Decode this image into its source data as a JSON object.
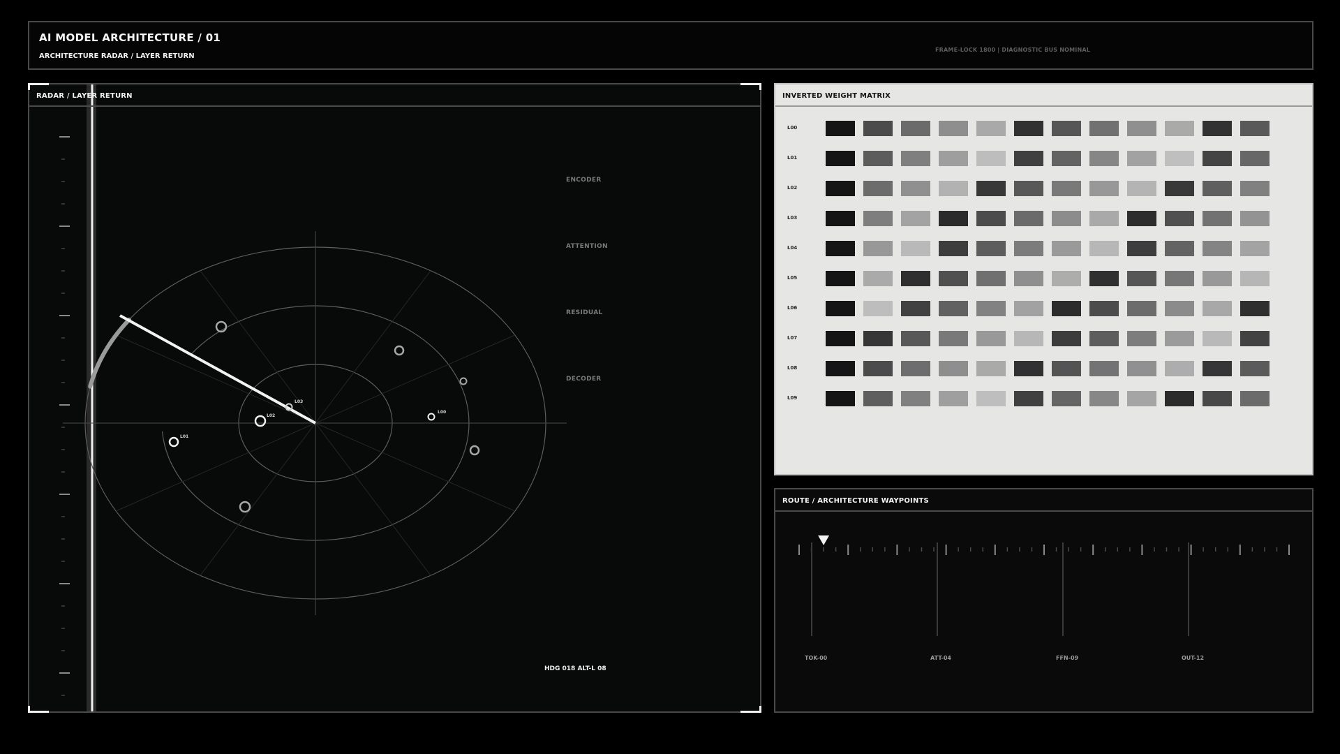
{
  "header": {
    "title": "AI MODEL ARCHITECTURE / 01",
    "subtitle": "ARCHITECTURE RADAR / LAYER RETURN",
    "status": "FRAME-LOCK 1800 | DIAGNOSTIC BUS NOMINAL"
  },
  "radar": {
    "title": "RADAR / LAYER RETURN",
    "layers": [
      "ENCODER",
      "ATTENTION",
      "RESIDUAL",
      "DECODER"
    ],
    "blip_labels": [
      {
        "id": "L01",
        "label": "L01"
      },
      {
        "id": "L02",
        "label": "L02"
      },
      {
        "id": "L03",
        "label": "L03"
      },
      {
        "id": "L00",
        "label": "L00"
      }
    ],
    "readout": "HDG 018  ALT-L 08",
    "sweep_heading_deg": 298
  },
  "matrix": {
    "title": "INVERTED WEIGHT MATRIX",
    "rows": [
      {
        "label": "L00",
        "cells": [
          "#141514",
          "#4a4b4a",
          "#6a6b6a",
          "#8d8e8d",
          "#a8a9a8",
          "#303130",
          "#555655",
          "#707170",
          "#8e8f8e",
          "#aaaba9",
          "#313231",
          "#585958"
        ]
      },
      {
        "label": "L01",
        "cells": [
          "#141514",
          "#5b5c5b",
          "#7e7f7e",
          "#9d9e9d",
          "#bcbdbc",
          "#3f403f",
          "#626362",
          "#858685",
          "#a1a2a1",
          "#bebfbe",
          "#434443",
          "#666766"
        ]
      },
      {
        "label": "L02",
        "cells": [
          "#141514",
          "#6b6c6b",
          "#8f908f",
          "#b1b2b1",
          "#373837",
          "#575857",
          "#787978",
          "#979897",
          "#b3b4b3",
          "#383938",
          "#5e5f5e",
          "#7f807f"
        ]
      },
      {
        "label": "L03",
        "cells": [
          "#141514",
          "#7d7e7d",
          "#a2a3a2",
          "#2a2b2a",
          "#4b4c4b",
          "#6a6b6a",
          "#8b8c8b",
          "#a8a9a8",
          "#2c2d2c",
          "#4f504f",
          "#717271",
          "#929392"
        ]
      },
      {
        "label": "L04",
        "cells": [
          "#141514",
          "#979897",
          "#b8b9b8",
          "#3c3d3c",
          "#5c5d5c",
          "#7b7c7b",
          "#999a99",
          "#b6b7b6",
          "#3d3e3d",
          "#626362",
          "#838483",
          "#a2a3a2"
        ]
      },
      {
        "label": "L05",
        "cells": [
          "#141514",
          "#a9aaa9",
          "#2e2f2e",
          "#4f504f",
          "#6f706f",
          "#8e8f8e",
          "#adaeac",
          "#2f302f",
          "#555655",
          "#767776",
          "#989998",
          "#b5b6b5"
        ]
      },
      {
        "label": "L06",
        "cells": [
          "#141514",
          "#bcbdbc",
          "#404140",
          "#606160",
          "#818281",
          "#a1a2a1",
          "#2b2c2b",
          "#4b4c4b",
          "#6b6c6b",
          "#8a8b8a",
          "#a7a8a7",
          "#2e2f2e"
        ]
      },
      {
        "label": "L07",
        "cells": [
          "#141514",
          "#353635",
          "#575857",
          "#787978",
          "#989998",
          "#b6b7b6",
          "#3b3c3b",
          "#5c5d5c",
          "#7c7d7c",
          "#9a9b9a",
          "#b8b9b8",
          "#414241"
        ]
      },
      {
        "label": "L08",
        "cells": [
          "#141514",
          "#4a4b4a",
          "#6c6d6c",
          "#8d8e8d",
          "#aaaba9",
          "#303130",
          "#535453",
          "#727372",
          "#8f908f",
          "#acadac",
          "#353635",
          "#5a5b5a"
        ]
      },
      {
        "label": "L09",
        "cells": [
          "#141514",
          "#5d5e5d",
          "#7f807f",
          "#9e9f9e",
          "#bdbebd",
          "#3f403f",
          "#646564",
          "#868786",
          "#a4a5a4",
          "#2a2b2a",
          "#474847",
          "#6a6b6a"
        ]
      }
    ]
  },
  "route": {
    "title": "ROUTE / ARCHITECTURE WAYPOINTS",
    "waypoints": [
      {
        "label": "TOK-00"
      },
      {
        "label": "ATT-04"
      },
      {
        "label": "FFN-09"
      },
      {
        "label": "OUT-12"
      }
    ],
    "marker_progress": 0.05
  },
  "colors": {
    "background": "#000000",
    "panel_border": "#4a4a4a",
    "matrix_bg": "#e6e7e4",
    "accent": "#f0f0f0"
  },
  "icons": {
    "route_marker": "triangle-down-icon",
    "blip": "circle-icon"
  }
}
